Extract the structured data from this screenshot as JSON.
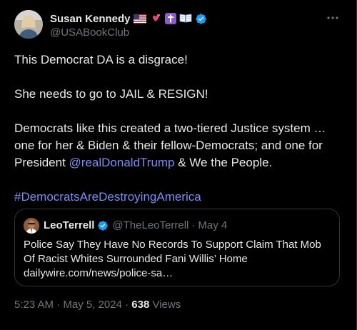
{
  "author": {
    "display_name": "Susan Kennedy",
    "handle": "@USABookClub"
  },
  "tweet": {
    "line1": "This Democrat DA is a disgrace!",
    "line2": "She needs to go to JAIL & RESIGN!",
    "line3_a": "Democrats like this created a two-tiered Justice system … one for her & Biden & their fellow-Democrats; and one for President ",
    "mention": "@realDonaldTrump",
    "line3_b": " & We the People.",
    "hashtag": "#DemocratsAreDestroyingAmerica"
  },
  "quote": {
    "display_name": "LeoTerrell",
    "handle": "@TheLeoTerrell",
    "separator": "·",
    "date": "May 4",
    "text": "Police Say They Have No Records To Support Claim That Mob Of Racist Whites Surrounded Fani Willis’ Home",
    "link": "dailywire.com/news/police-sa…"
  },
  "meta": {
    "time": "5:23 AM",
    "sep1": " · ",
    "date": "May 5, 2024",
    "sep2": " · ",
    "views_count": "638",
    "views_label": " Views"
  },
  "icons": {
    "verified": "verified-badge-icon",
    "more": "more-options-icon"
  },
  "colors": {
    "background": "#000000",
    "text": "#e7e9ea",
    "secondary": "#71767b",
    "link": "#7e8cf5",
    "verified": "#1d9bf0",
    "border": "#2f3336"
  }
}
